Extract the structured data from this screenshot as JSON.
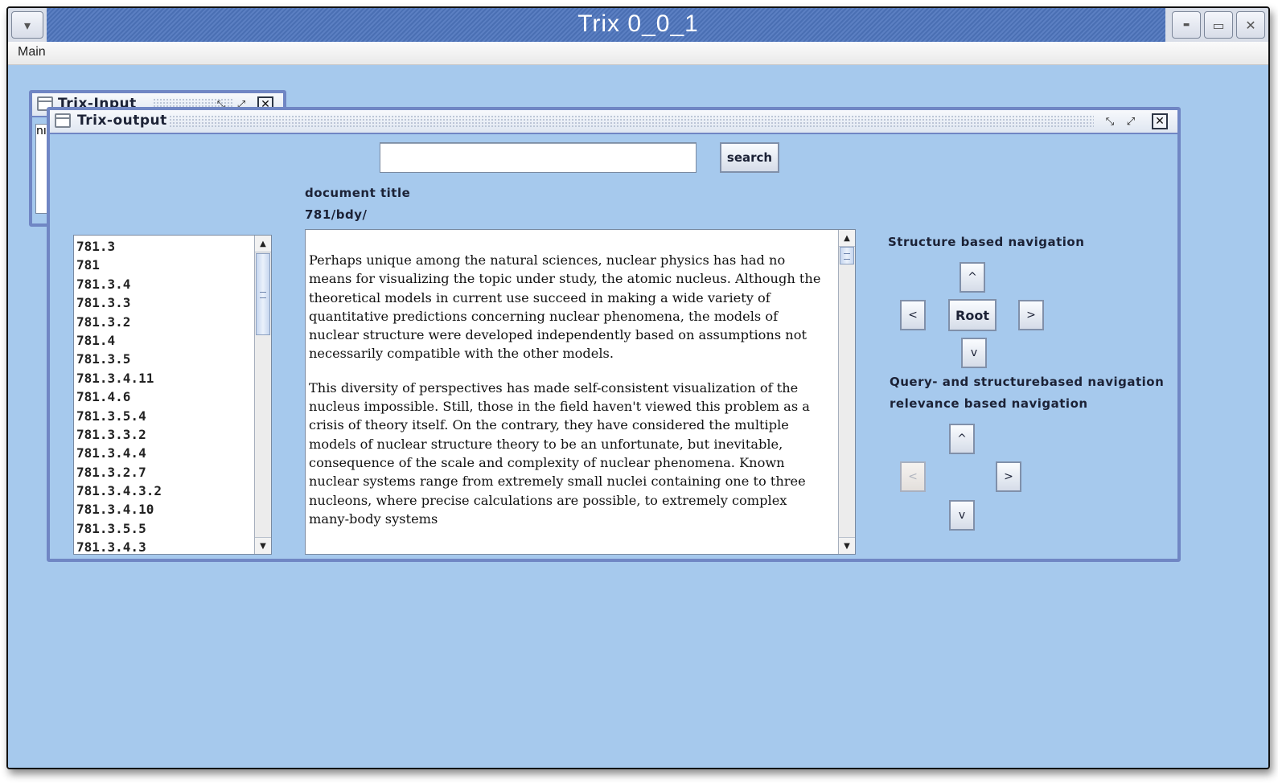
{
  "app": {
    "title": "Trix 0_0_1",
    "window_controls": {
      "menu": "▾",
      "minimize": "▬",
      "maximize": "▭",
      "close": "✕"
    },
    "menu": [
      {
        "label": "Main"
      }
    ]
  },
  "input_frame": {
    "title": "Trix-Input",
    "visible_text_fragment": "nı"
  },
  "output_frame": {
    "title": "Trix-output",
    "controls": {
      "iconify": "⤡",
      "maximize": "⤢",
      "close": "☒"
    },
    "search": {
      "value": "",
      "placeholder": "",
      "button_label": "search"
    },
    "document_title_label": "document title",
    "document_path": "781/bdy/",
    "element_list": [
      "781.3",
      "781",
      "781.3.4",
      "781.3.3",
      "781.3.2",
      "781.4",
      "781.3.5",
      "781.3.4.11",
      "781.4.6",
      "781.3.5.4",
      "781.3.3.2",
      "781.3.4.4",
      "781.3.2.7",
      "781.3.4.3.2",
      "781.3.4.10",
      "781.3.5.5",
      "781.3.4.3"
    ],
    "document_paragraphs": [
      "Perhaps unique among the natural sciences, nuclear physics has had no means for visualizing the topic under study, the atomic nucleus. Although the theoretical models in current use succeed in making a wide variety of quantitative predictions concerning nuclear phenomena, the models of nuclear structure were developed independently based on assumptions not necessarily compatible with the other models.",
      "This diversity of perspectives has made self-consistent visualization of the nucleus impossible. Still, those in the field haven't viewed this problem as a crisis of theory itself. On the contrary, they have considered the multiple models of nuclear structure theory to be an unfortunate, but inevitable, consequence of the scale and complexity of nuclear phenomena. Known nuclear systems range from extremely small nuclei containing one to three nucleons, where precise calculations are possible, to extremely complex many-body systems"
    ],
    "structure_nav": {
      "label": "Structure based navigation",
      "up": "^",
      "left": "<",
      "root": "Root",
      "right": ">",
      "down": "v"
    },
    "query_structure_nav": {
      "label": "Query- and structurebased navigation"
    },
    "relevance_nav": {
      "label": "relevance based navigation",
      "up": "^",
      "left": "<",
      "right": ">",
      "down": "v",
      "left_disabled": true
    },
    "scroll": {
      "arrow_up": "▲",
      "arrow_down": "▼"
    }
  }
}
